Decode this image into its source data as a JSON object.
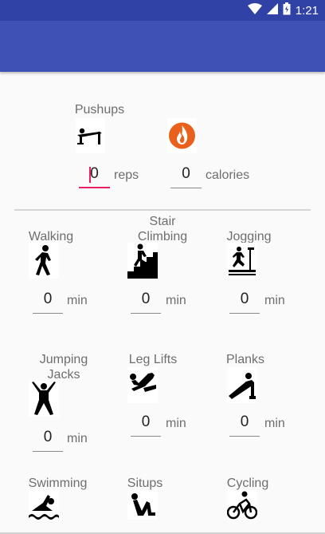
{
  "status_bar": {
    "time": "1:21",
    "icons": [
      "wifi-icon",
      "signal-icon",
      "battery-icon"
    ],
    "color": "#3042a5"
  },
  "app_bar": {
    "color": "#3f51b5"
  },
  "accent_color": "#e91e63",
  "pushups": {
    "label": "Pushups",
    "reps_value": "0",
    "reps_unit": "reps",
    "calories_value": "0",
    "calories_unit": "calories",
    "icon": "pushup-icon",
    "calories_icon": "flame-icon"
  },
  "exercises": [
    {
      "label": "Walking",
      "value": "0",
      "unit": "min",
      "icon": "walking-icon"
    },
    {
      "label": "Stair Climbing",
      "value": "0",
      "unit": "min",
      "icon": "stair-climbing-icon"
    },
    {
      "label": "Jogging",
      "value": "0",
      "unit": "min",
      "icon": "treadmill-icon"
    },
    {
      "label": "Jumping Jacks",
      "value": "0",
      "unit": "min",
      "icon": "jumping-jacks-icon"
    },
    {
      "label": "Leg Lifts",
      "value": "0",
      "unit": "min",
      "icon": "leg-lifts-icon"
    },
    {
      "label": "Planks",
      "value": "0",
      "unit": "min",
      "icon": "planks-icon"
    },
    {
      "label": "Swimming",
      "icon": "swimming-icon"
    },
    {
      "label": "Situps",
      "icon": "situps-icon"
    },
    {
      "label": "Cycling",
      "icon": "cycling-icon"
    }
  ]
}
